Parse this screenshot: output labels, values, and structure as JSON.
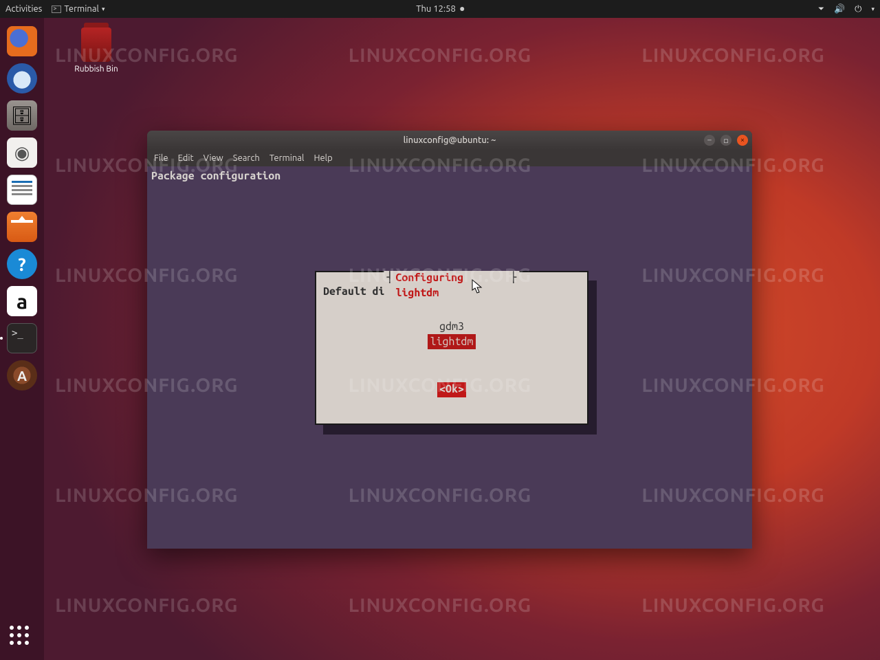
{
  "topbar": {
    "activities": "Activities",
    "app_indicator": "Terminal ▾",
    "clock": "Thu 12:58"
  },
  "desktop": {
    "trash_label": "Rubbish Bin"
  },
  "dock": {
    "items": [
      "firefox",
      "thunderbird",
      "files",
      "rhythmbox",
      "writer",
      "software",
      "help",
      "amazon",
      "terminal",
      "updater"
    ]
  },
  "window": {
    "title": "linuxconfig@ubuntu: ~",
    "menus": {
      "file": "File",
      "edit": "Edit",
      "view": "View",
      "search": "Search",
      "terminal": "Terminal",
      "help": "Help"
    }
  },
  "terminal": {
    "header": "Package configuration"
  },
  "dialog": {
    "title": "Configuring lightdm",
    "prompt": "Default display manager:",
    "options": [
      "gdm3",
      "lightdm"
    ],
    "selected_index": 1,
    "ok": "<Ok>"
  },
  "watermark": "LINUXCONFIG.ORG"
}
